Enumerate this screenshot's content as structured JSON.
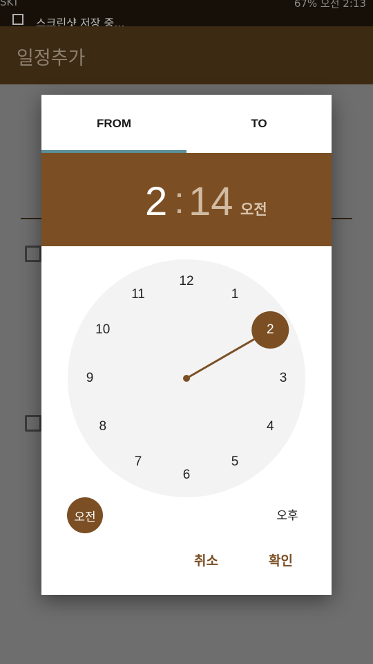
{
  "status_bar": {
    "left_text": "SKT",
    "right_text": "67% 오전 2:13",
    "notification": "스크린샷 저장 중..."
  },
  "app_bar": {
    "title": "일정추가"
  },
  "dialog": {
    "tabs": [
      {
        "label": "FROM",
        "active": true
      },
      {
        "label": "TO",
        "active": false
      }
    ],
    "time": {
      "hour": "2",
      "separator": ":",
      "minute": "14",
      "period": "오전"
    },
    "clock": {
      "numbers": [
        "12",
        "1",
        "2",
        "3",
        "4",
        "5",
        "6",
        "7",
        "8",
        "9",
        "10",
        "11"
      ],
      "selected_hour": 2
    },
    "am_label": "오전",
    "pm_label": "오후",
    "cancel_label": "취소",
    "ok_label": "확인"
  },
  "colors": {
    "accent": "#7b4f23",
    "tab_indicator": "#5b8f9a",
    "clock_face": "#f3f3f3"
  }
}
